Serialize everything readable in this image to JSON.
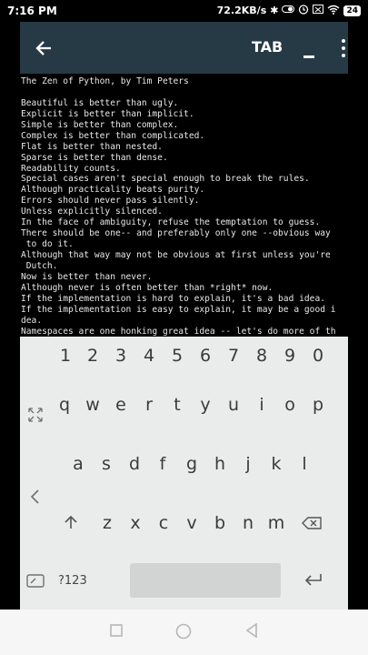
{
  "status_bar": {
    "time": "7:16 PM",
    "speed": "72.2KB/s",
    "battery": "24",
    "icons": [
      "bluetooth-icon",
      "toggle-icon",
      "alarm-icon",
      "x-box-icon",
      "wifi-icon",
      "battery-icon"
    ]
  },
  "app_bar": {
    "tab_label": "TAB",
    "back_icon": "arrow-left-icon",
    "minimize_icon": "minimize-icon",
    "menu_icon": "more-vert-icon",
    "background": "#263a45"
  },
  "terminal": {
    "lines": [
      "The Zen of Python, by Tim Peters",
      "",
      "Beautiful is better than ugly.",
      "Explicit is better than implicit.",
      "Simple is better than complex.",
      "Complex is better than complicated.",
      "Flat is better than nested.",
      "Sparse is better than dense.",
      "Readability counts.",
      "Special cases aren't special enough to break the rules.",
      "Although practicality beats purity.",
      "Errors should never pass silently.",
      "Unless explicitly silenced.",
      "In the face of ambiguity, refuse the temptation to guess.",
      "There should be one-- and preferably only one --obvious way",
      " to do it.",
      "Although that way may not be obvious at first unless you're",
      " Dutch.",
      "Now is better than never.",
      "Although never is often better than *right* now.",
      "If the implementation is hard to explain, it's a bad idea.",
      "If the implementation is easy to explain, it may be a good i",
      "dea.",
      "Namespaces are one honking great idea -- let's do more of th"
    ]
  },
  "keyboard": {
    "numbers": [
      "1",
      "2",
      "3",
      "4",
      "5",
      "6",
      "7",
      "8",
      "9",
      "0"
    ],
    "row1": [
      "q",
      "w",
      "e",
      "r",
      "t",
      "y",
      "u",
      "i",
      "o",
      "p"
    ],
    "row2": [
      "a",
      "s",
      "d",
      "f",
      "g",
      "h",
      "j",
      "k",
      "l"
    ],
    "row3": [
      "z",
      "x",
      "c",
      "v",
      "b",
      "n",
      "m"
    ],
    "symbols_label": "?123",
    "background": "#e9ecea"
  },
  "nav_bar": {
    "icons": [
      "square-icon",
      "circle-icon",
      "back-triangle-icon"
    ]
  }
}
